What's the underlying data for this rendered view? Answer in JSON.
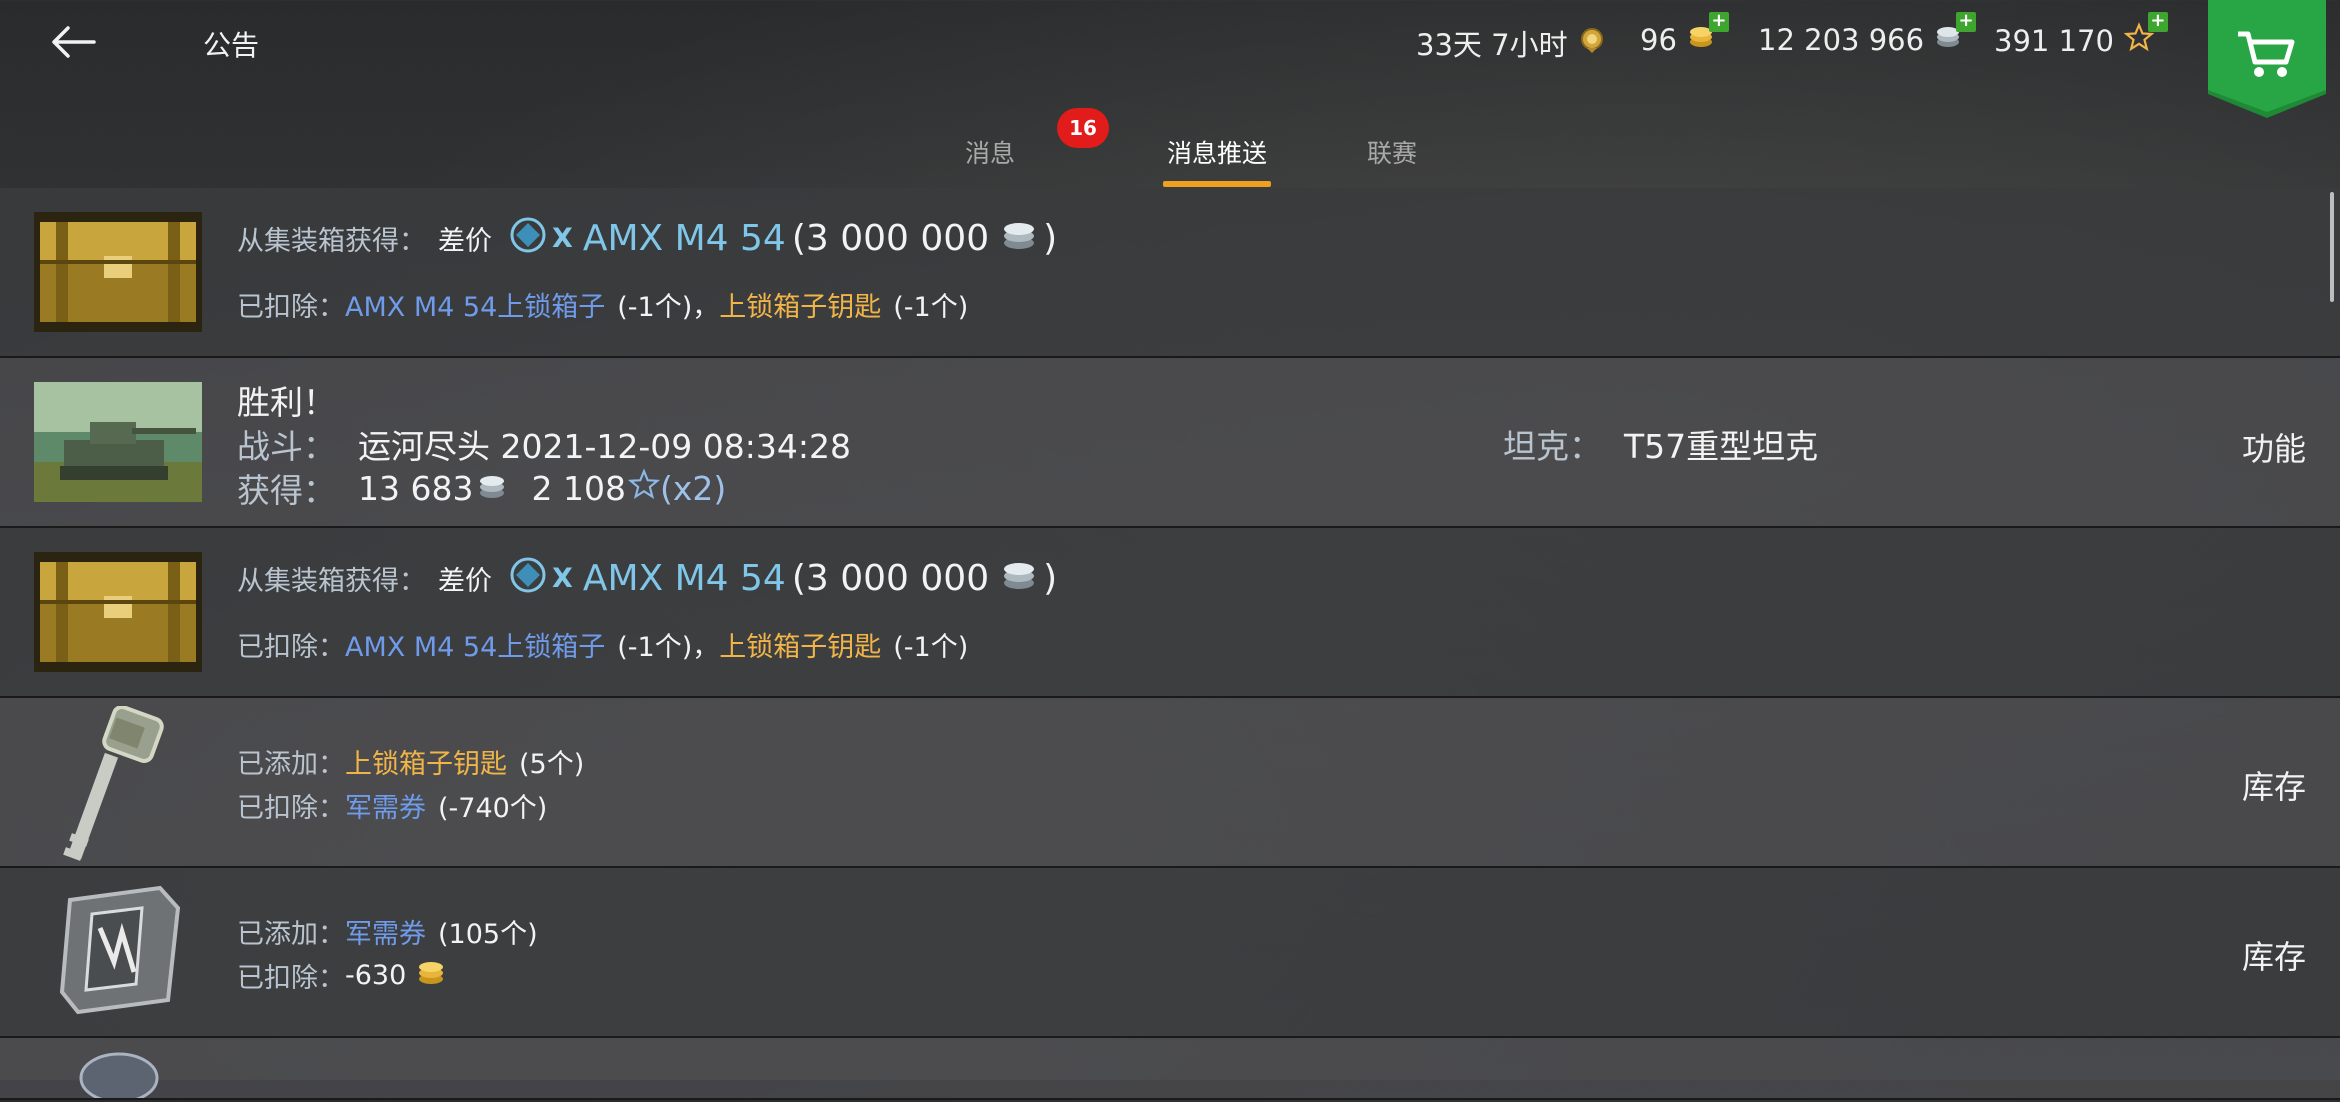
{
  "header": {
    "title": "公告",
    "premium_time": "33天 7小时",
    "gold": "96",
    "credits": "12 203 966",
    "free_xp": "391 170"
  },
  "tabs": [
    {
      "label": "消息",
      "badge": "16"
    },
    {
      "label": "消息推送",
      "active": true
    },
    {
      "label": "联赛"
    }
  ],
  "rows": [
    {
      "type": "container",
      "from_label": "从集装箱获得：",
      "discount_label": "差价",
      "tier": "X",
      "tank": "AMX M4 54",
      "amount": "(3 000 000",
      "close": ")",
      "deducted_label": "已扣除：",
      "item1": "AMX M4 54上锁箱子",
      "item1_count": "(-1个)",
      "sep": "，",
      "item2": "上锁箱子钥匙",
      "item2_count": "(-1个)"
    },
    {
      "type": "battle",
      "result": "胜利！",
      "battle_label": "战斗：",
      "battle_value": "运河尽头 2021-12-09 08:34:28",
      "earned_label": "获得：",
      "credits": "13 683",
      "xp": "2 108",
      "multiplier": "(x2)",
      "tank_label": "坦克：",
      "tank_value": "T57重型坦克",
      "action": "功能"
    },
    {
      "type": "container",
      "from_label": "从集装箱获得：",
      "discount_label": "差价",
      "tier": "X",
      "tank": "AMX M4 54",
      "amount": "(3 000 000",
      "close": ")",
      "deducted_label": "已扣除：",
      "item1": "AMX M4 54上锁箱子",
      "item1_count": "(-1个)",
      "sep": "，",
      "item2": "上锁箱子钥匙",
      "item2_count": "(-1个)"
    },
    {
      "type": "key",
      "added_label": "已添加：",
      "added_item": "上锁箱子钥匙",
      "added_count": "(5个)",
      "deducted_label": "已扣除：",
      "deducted_item": "军需券",
      "deducted_count": "(-740个)",
      "action": "库存"
    },
    {
      "type": "voucher",
      "added_label": "已添加：",
      "added_item": "军需券",
      "added_count": "(105个)",
      "deducted_label": "已扣除：",
      "deducted_value": "-630",
      "action": "库存"
    }
  ],
  "colors": {
    "accent": "#f0a020",
    "badge": "#e21b1b",
    "link_blue": "#6f9bea",
    "gold": "#f0b448",
    "cart_green": "#1f8a36"
  },
  "icons": [
    "back-arrow-icon",
    "premium-icon",
    "gold-coin-icon",
    "credits-icon",
    "freexp-star-icon",
    "shopping-cart-icon"
  ]
}
